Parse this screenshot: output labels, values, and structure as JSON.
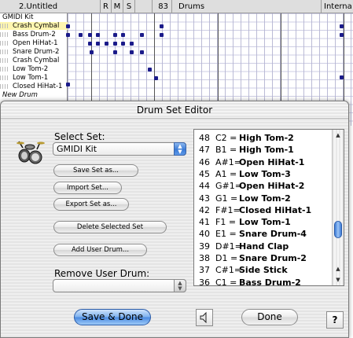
{
  "sequencer": {
    "header": {
      "sequence_name": "2.Untitled",
      "flags": [
        "R",
        "M",
        "S"
      ],
      "number": "83",
      "track_name": "Drums",
      "device": "Interna"
    },
    "kit_name": "GMIDI Kit",
    "tracks": [
      {
        "name": "Crash Cymbal",
        "highlighted": true
      },
      {
        "name": "Bass Drum-2",
        "highlighted": false
      },
      {
        "name": "Open HiHat-1",
        "highlighted": false
      },
      {
        "name": "Snare Drum-2",
        "highlighted": false
      },
      {
        "name": "Crash Cymbal",
        "highlighted": false
      },
      {
        "name": "Low Tom-2",
        "highlighted": false
      },
      {
        "name": "Low Tom-1",
        "highlighted": false
      },
      {
        "name": "Closed HiHat-1",
        "highlighted": false
      }
    ],
    "new_drum_label": "New Drum",
    "note_color": "#1b1b8a"
  },
  "dialog": {
    "title": "Drum Set Editor",
    "select_set_label": "Select Set:",
    "selected_set": "GMIDI Kit",
    "buttons": {
      "save_set_as": "Save Set as...",
      "import_set": "Import Set...",
      "export_set_as": "Export Set as...",
      "delete_selected_set": "Delete Selected Set",
      "add_user_drum": "Add User Drum..."
    },
    "remove_user_drum_label": "Remove User Drum:",
    "remove_user_drum_value": "",
    "drum_list": [
      {
        "num": "48",
        "key": "C2 =",
        "name": "High Tom-2"
      },
      {
        "num": "47",
        "key": "B1 =",
        "name": "High Tom-1"
      },
      {
        "num": "46",
        "key": "A#1=",
        "name": "Open HiHat-1"
      },
      {
        "num": "45",
        "key": "A1 =",
        "name": "Low Tom-3"
      },
      {
        "num": "44",
        "key": "G#1=",
        "name": "Open HiHat-2"
      },
      {
        "num": "43",
        "key": "G1 =",
        "name": "Low Tom-2"
      },
      {
        "num": "42",
        "key": "F#1=",
        "name": "Closed HiHat-1"
      },
      {
        "num": "41",
        "key": "F1 =",
        "name": "Low Tom-1"
      },
      {
        "num": "40",
        "key": "E1 =",
        "name": "Snare Drum-4"
      },
      {
        "num": "39",
        "key": "D#1=",
        "name": "Hand Clap"
      },
      {
        "num": "38",
        "key": "D1 =",
        "name": "Snare Drum-2"
      },
      {
        "num": "37",
        "key": "C#1=",
        "name": "Side Stick"
      },
      {
        "num": "36",
        "key": "C1 =",
        "name": "Bass Drum-2"
      }
    ],
    "save_done_label": "Save & Done",
    "done_label": "Done",
    "help_label": "?",
    "accent_color": "#4a8ae0"
  }
}
